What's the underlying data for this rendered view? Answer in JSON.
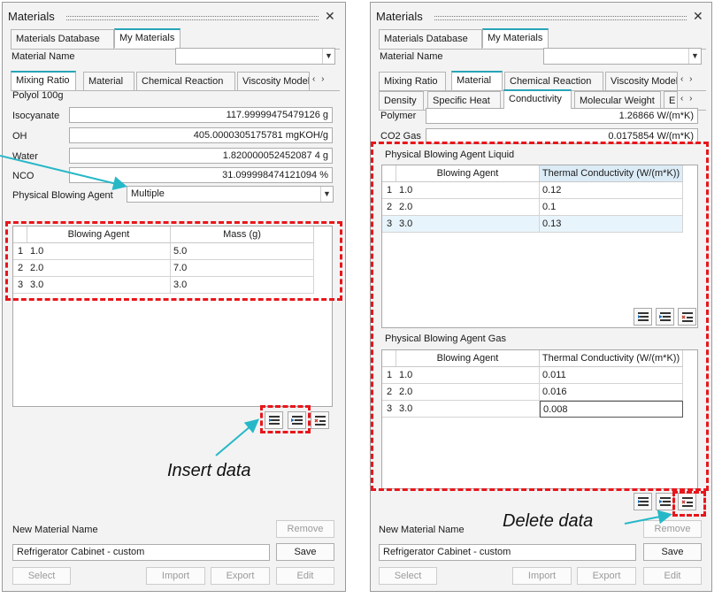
{
  "left": {
    "title": "Materials",
    "tabs_top": [
      "Materials Database",
      "My Materials"
    ],
    "material_name_label": "Material Name",
    "material_name_value": "",
    "tabs": [
      "Mixing Ratio",
      "Material",
      "Chemical Reaction",
      "Viscosity Model"
    ],
    "polyol_label": "Polyol 100g",
    "fields": [
      {
        "label": "Isocyanate",
        "value": "117.99999475479126 g"
      },
      {
        "label": "OH",
        "value": "405.0000305175781 mgKOH/g"
      },
      {
        "label": "Water",
        "value": "1.820000052452087 4 g"
      },
      {
        "label": "NCO",
        "value": "31.099998474121094 %"
      }
    ],
    "blowing_agent_label": "Physical Blowing Agent",
    "blowing_agent_value": "Multiple",
    "table": {
      "columns": [
        "Blowing Agent",
        "Mass (g)"
      ],
      "rows": [
        {
          "n": "1",
          "agent": "1.0",
          "value": "5.0"
        },
        {
          "n": "2",
          "agent": "2.0",
          "value": "7.0"
        },
        {
          "n": "3",
          "agent": "3.0",
          "value": "3.0"
        }
      ]
    },
    "new_material_label": "New Material Name",
    "new_material_value": "Refrigerator Cabinet - custom",
    "buttons": {
      "remove": "Remove",
      "save": "Save",
      "select": "Select",
      "import": "Import",
      "export": "Export",
      "edit": "Edit"
    }
  },
  "right": {
    "title": "Materials",
    "tabs_top": [
      "Materials Database",
      "My Materials"
    ],
    "material_name_label": "Material Name",
    "material_name_value": "",
    "tabs": [
      "Mixing Ratio",
      "Material",
      "Chemical Reaction",
      "Viscosity Model"
    ],
    "subtabs": [
      "Density",
      "Specific Heat",
      "Conductivity",
      "Molecular Weight",
      "E"
    ],
    "fields": [
      {
        "label": "Polymer",
        "value": "1.26866 W/(m*K)"
      },
      {
        "label": "CO2 Gas",
        "value": "0.0175854 W/(m*K)"
      }
    ],
    "liquid": {
      "title": "Physical Blowing Agent Liquid",
      "columns": [
        "Blowing Agent",
        "Thermal Conductivity (W/(m*K))"
      ],
      "rows": [
        {
          "n": "1",
          "agent": "1.0",
          "value": "0.12"
        },
        {
          "n": "2",
          "agent": "2.0",
          "value": "0.1"
        },
        {
          "n": "3",
          "agent": "3.0",
          "value": "0.13"
        }
      ]
    },
    "gas": {
      "title": "Physical Blowing Agent Gas",
      "columns": [
        "Blowing Agent",
        "Thermal Conductivity (W/(m*K))"
      ],
      "rows": [
        {
          "n": "1",
          "agent": "1.0",
          "value": "0.011"
        },
        {
          "n": "2",
          "agent": "2.0",
          "value": "0.016"
        },
        {
          "n": "3",
          "agent": "3.0",
          "value": "0.008"
        }
      ]
    },
    "new_material_label": "New Material Name",
    "new_material_value": "Refrigerator Cabinet - custom",
    "buttons": {
      "remove": "Remove",
      "save": "Save",
      "select": "Select",
      "import": "Import",
      "export": "Export",
      "edit": "Edit"
    }
  },
  "annotations": {
    "insert": "Insert data",
    "delete": "Delete data"
  },
  "colors": {
    "accent": "#27a4b7",
    "highlight": "#e8161b",
    "arrow": "#27b8c8"
  }
}
